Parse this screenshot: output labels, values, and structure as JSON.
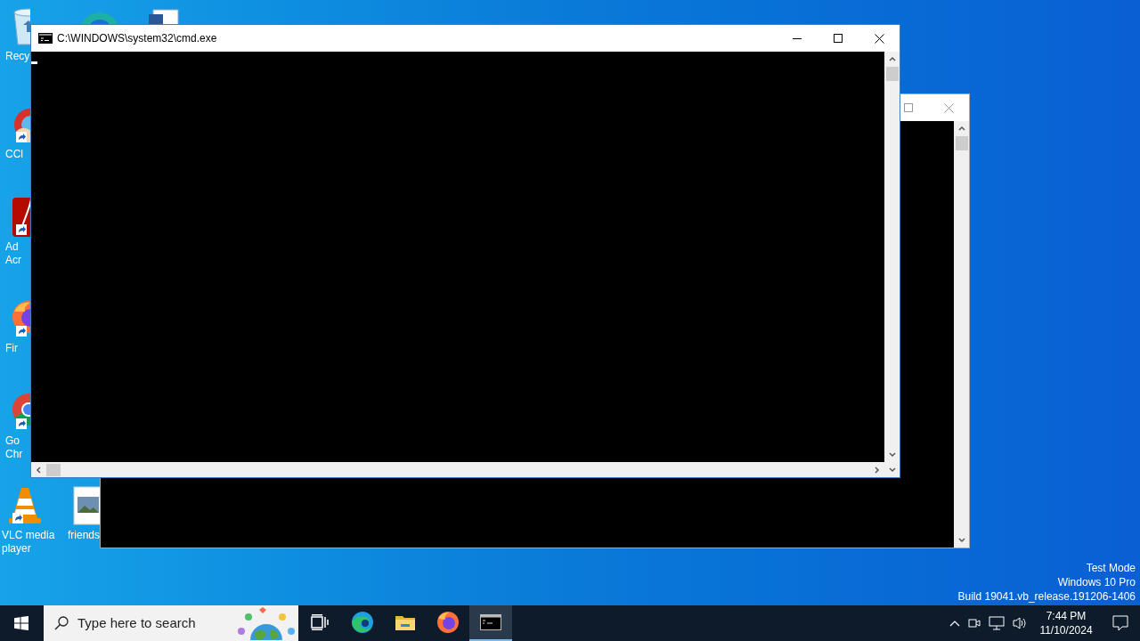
{
  "desktop_icons": [
    {
      "kind": "recycle",
      "lines": [
        "Recy"
      ]
    },
    {
      "kind": "ccleaner",
      "lines": [
        "CCl"
      ]
    },
    {
      "kind": "acrobat",
      "lines": [
        "Ad",
        "Acr"
      ]
    },
    {
      "kind": "firefox",
      "lines": [
        "Fir"
      ]
    },
    {
      "kind": "chrome",
      "lines": [
        "Go",
        "Chr"
      ]
    },
    {
      "kind": "vlc",
      "lines": [
        "VLC media",
        "player"
      ]
    },
    {
      "kind": "image",
      "lines": [
        "friends"
      ]
    }
  ],
  "console_window": {
    "title": "C:\\WINDOWS\\system32\\cmd.exe",
    "active": true
  },
  "watermark": [
    "Test Mode",
    "Windows 10 Pro",
    "Build 19041.vb_release.191206-1406"
  ],
  "taskbar": {
    "search": {
      "placeholder": "Type here to search"
    },
    "apps": [
      {
        "kind": "task-view",
        "selected": false
      },
      {
        "kind": "edge",
        "selected": false
      },
      {
        "kind": "explorer",
        "selected": false
      },
      {
        "kind": "firefox",
        "selected": false
      },
      {
        "kind": "terminal",
        "selected": true
      }
    ],
    "clock": {
      "time": "7:44 PM",
      "date": "11/10/2024"
    }
  }
}
